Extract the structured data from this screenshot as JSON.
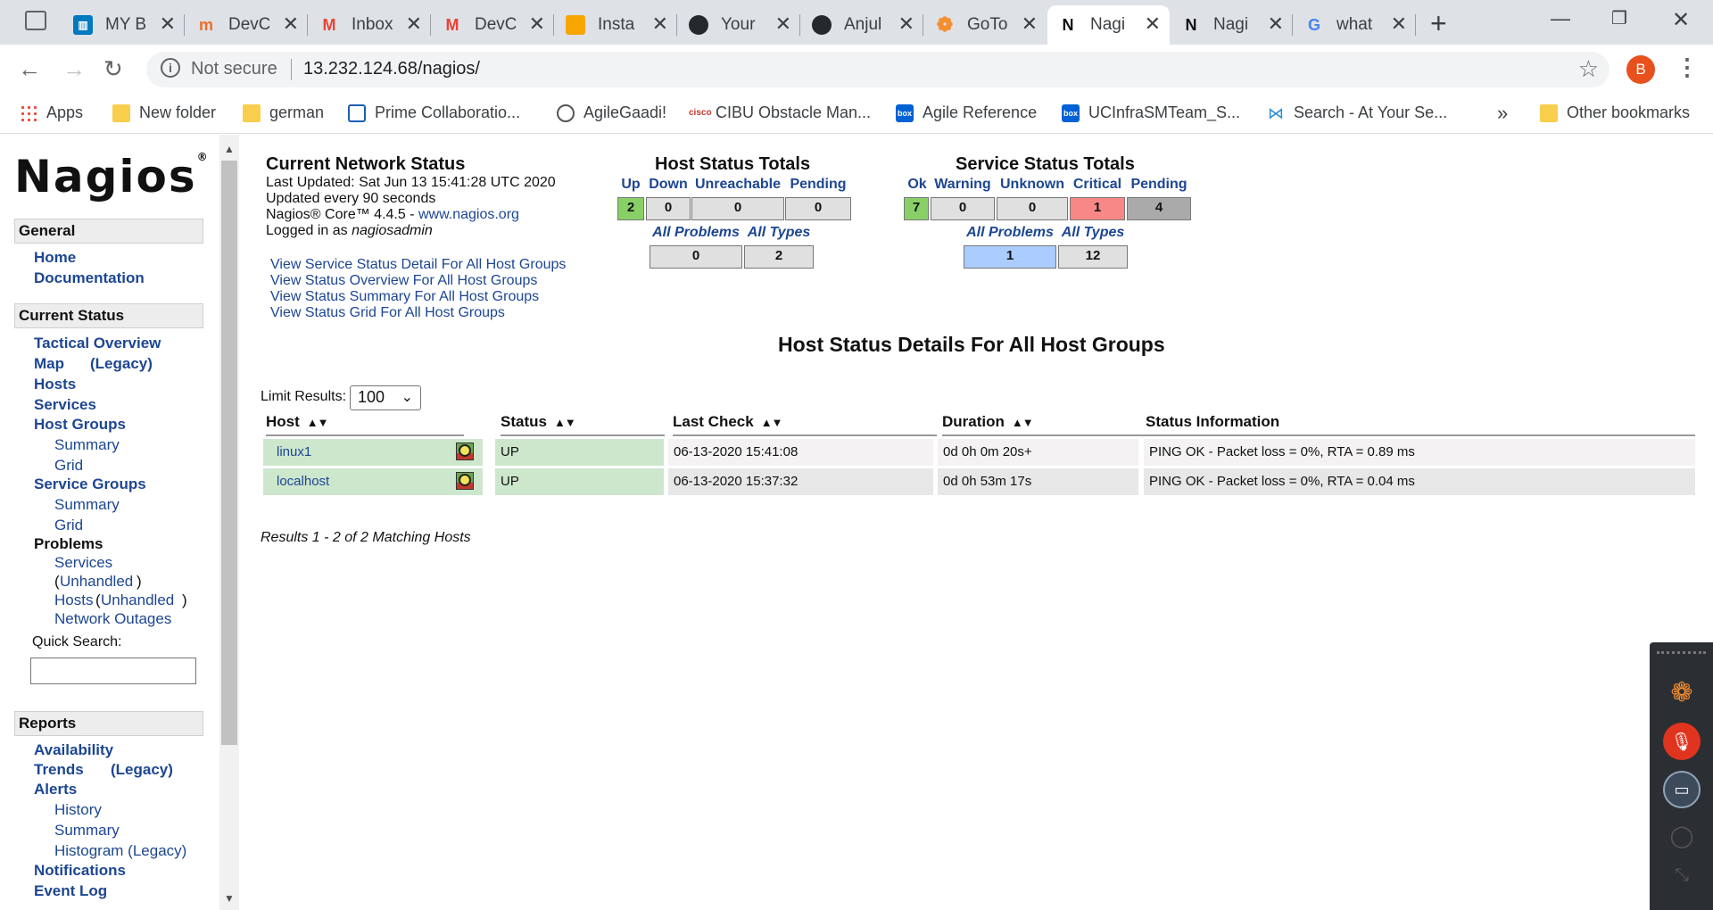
{
  "browser": {
    "tabs": [
      {
        "label": "MY B",
        "icon": "trello-icon",
        "color": "#0079bf"
      },
      {
        "label": "DevC",
        "icon": "jira-icon",
        "color": "#f06d26"
      },
      {
        "label": "Inbox",
        "icon": "gmail-icon",
        "color": "#ea4335"
      },
      {
        "label": "DevC",
        "icon": "gmail-icon",
        "color": "#ea4335"
      },
      {
        "label": "Insta",
        "icon": "aws-icon",
        "color": "#f7a600"
      },
      {
        "label": "Your",
        "icon": "github-icon",
        "color": "#24292e"
      },
      {
        "label": "Anjul",
        "icon": "github-icon",
        "color": "#24292e"
      },
      {
        "label": "GoTo",
        "icon": "gotomeeting-icon",
        "color": "#f68d2e"
      },
      {
        "label": "Nagi",
        "icon": "nagios-icon",
        "color": "#111111",
        "active": true
      },
      {
        "label": "Nagi",
        "icon": "nagios-icon",
        "color": "#111111"
      },
      {
        "label": "what",
        "icon": "google-icon",
        "color": "#4285f4"
      }
    ],
    "address": {
      "security": "Not secure",
      "url": "13.232.124.68/nagios/"
    },
    "profile_initial": "B",
    "bookmarks": [
      {
        "label": "Apps",
        "icon": "apps-icon"
      },
      {
        "label": "New folder",
        "icon": "folder-icon"
      },
      {
        "label": "german",
        "icon": "folder-icon"
      },
      {
        "label": "Prime Collaboratio...",
        "icon": "prime-icon"
      },
      {
        "label": "AgileGaadi!",
        "icon": "agile-icon"
      },
      {
        "label": "CIBU Obstacle Man...",
        "icon": "cisco-icon"
      },
      {
        "label": "Agile Reference",
        "icon": "box-icon"
      },
      {
        "label": "UCInfraSMTeam_S...",
        "icon": "box-icon"
      },
      {
        "label": "Search - At Your Se...",
        "icon": "search-at-your-service-icon"
      }
    ],
    "other_bookmarks": "Other bookmarks"
  },
  "sidebar": {
    "logo": "Nagios",
    "logo_mark": "®",
    "general": {
      "title": "General",
      "home": "Home",
      "documentation": "Documentation"
    },
    "current_status": {
      "title": "Current Status",
      "tactical_overview": "Tactical Overview",
      "map": "Map",
      "map_legacy": "(Legacy)",
      "hosts": "Hosts",
      "services": "Services",
      "host_groups": "Host Groups",
      "hg_summary": "Summary",
      "hg_grid": "Grid",
      "service_groups": "Service Groups",
      "sg_summary": "Summary",
      "sg_grid": "Grid",
      "problems": "Problems",
      "p_services": "Services",
      "p_services_unhandled": "Unhandled",
      "p_hosts": "Hosts",
      "p_hosts_unhandled": "Unhandled",
      "p_network_outages": "Network Outages",
      "quick_search": "Quick Search:"
    },
    "reports": {
      "title": "Reports",
      "availability": "Availability",
      "trends": "Trends",
      "trends_legacy": "(Legacy)",
      "alerts": "Alerts",
      "history": "History",
      "summary": "Summary",
      "histogram": "Histogram (Legacy)",
      "notifications": "Notifications",
      "event_log": "Event Log"
    }
  },
  "network_status": {
    "title": "Current Network Status",
    "last_updated": "Last Updated: Sat Jun 13 15:41:28 UTC 2020",
    "update_interval": "Updated every 90 seconds",
    "core_version": "Nagios® Core™ 4.4.5 - ",
    "core_link": "www.nagios.org",
    "logged_in_prefix": "Logged in as ",
    "logged_in_user": "nagiosadmin",
    "links": [
      "View Service Status Detail For All Host Groups",
      "View Status Overview For All Host Groups",
      "View Status Summary For All Host Groups",
      "View Status Grid For All Host Groups"
    ]
  },
  "host_totals": {
    "title": "Host Status Totals",
    "headers": [
      "Up",
      "Down",
      "Unreachable",
      "Pending"
    ],
    "values": [
      "2",
      "0",
      "0",
      "0"
    ],
    "sub_headers": [
      "All Problems",
      "All Types"
    ],
    "sub_values": [
      "0",
      "2"
    ]
  },
  "service_totals": {
    "title": "Service Status Totals",
    "headers": [
      "Ok",
      "Warning",
      "Unknown",
      "Critical",
      "Pending"
    ],
    "values": [
      "7",
      "0",
      "0",
      "1",
      "4"
    ],
    "sub_headers": [
      "All Problems",
      "All Types"
    ],
    "sub_values": [
      "1",
      "12"
    ]
  },
  "host_details": {
    "title": "Host Status Details For All Host Groups",
    "limit_label": "Limit Results:",
    "limit_value": "100",
    "columns": [
      "Host",
      "Status",
      "Last Check",
      "Duration",
      "Status Information"
    ],
    "rows": [
      {
        "host": "linux1",
        "status": "UP",
        "last_check": "06-13-2020 15:41:08",
        "duration": "0d 0h 0m 20s+",
        "info": "PING OK - Packet loss = 0%, RTA = 0.89 ms"
      },
      {
        "host": "localhost",
        "status": "UP",
        "last_check": "06-13-2020 15:37:32",
        "duration": "0d 0h 53m 17s",
        "info": "PING OK - Packet loss = 0%, RTA = 0.04 ms"
      }
    ],
    "results_text": "Results 1 - 2 of 2 Matching Hosts"
  },
  "colors": {
    "link": "#1d4692",
    "up_green": "#88d066",
    "critical_red": "#f88888",
    "pending_grey": "#aaaaaa",
    "problems_blue": "#aaccff",
    "row_ok": "#cde7cd"
  }
}
